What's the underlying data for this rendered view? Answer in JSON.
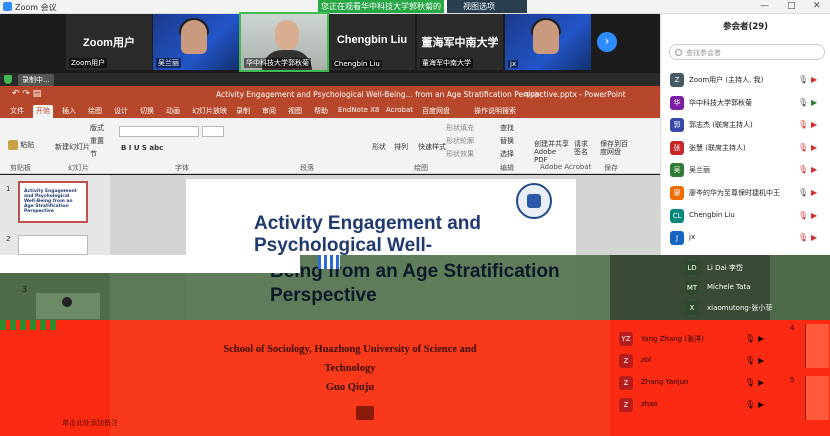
{
  "window": {
    "app_title": "Zoom 会议",
    "share_banner": "您正在观看华中科技大学郭秋菊的屏幕",
    "view_options": "视图选项",
    "controls": [
      "—",
      "□",
      "✕"
    ]
  },
  "gallery": {
    "tiles": [
      {
        "center": "Zoom用户",
        "caption": "Zoom用户"
      },
      {
        "caption": "吴兰丽"
      },
      {
        "caption": "华中科技大学郭秋菊"
      },
      {
        "center": "Chengbin Liu",
        "caption": "Chengbin Liu"
      },
      {
        "center": "董海军中南大学",
        "caption": "董海军中南大学"
      },
      {
        "caption": "jx"
      }
    ],
    "next_arrow": "›"
  },
  "recording": {
    "label": "录制中..."
  },
  "powerpoint": {
    "title": "Activity Engagement and Psychological Well-Being... from an Age Stratification Perspective.pptx - PowerPoint",
    "user": "qiuju",
    "share": "共享",
    "tabs": [
      "文件",
      "开始",
      "插入",
      "绘图",
      "设计",
      "切换",
      "动画",
      "幻灯片放映",
      "录制",
      "审阅",
      "视图",
      "帮助",
      "EndNote X8",
      "Acrobat",
      "百度网盘",
      "操作说明搜索"
    ],
    "active_tab": "开始",
    "ribbon": {
      "paste": "粘贴",
      "new_slide": "新建幻灯片",
      "layout": "版式",
      "reset": "重置",
      "section": "节",
      "shape": "形状",
      "arrange": "排列",
      "quick_styles": "快速样式",
      "shape_fill": "形状填充",
      "shape_outline": "形状轮廓",
      "shape_effect": "形状效果",
      "find": "查找",
      "replace": "替换",
      "select": "选择",
      "create_pdf": "创建并共享 Adobe PDF",
      "request_sign": "请求签名",
      "save_to_baidu": "保存到百度网盘",
      "groups": [
        "剪贴板",
        "幻灯片",
        "字体",
        "段落",
        "绘图",
        "编辑",
        "Adobe Acrobat",
        "保存"
      ]
    },
    "slides_panel": {
      "thumb1": "Activity Engagement and Psychological Well-Being from an Age Stratification Perspective",
      "numbers": [
        "1",
        "2",
        "3"
      ]
    },
    "slide": {
      "heading_top": "Activity Engagement and Psychological Well-",
      "heading_bottom": "Being from an Age Stratification Perspective",
      "affiliation": "School of  Sociology, Huazhong University of Science and Technology",
      "author": "Guo Qiuju",
      "bottom_note": "单击此处添加备注"
    },
    "right_slide_numbers": [
      "4",
      "5"
    ]
  },
  "participants": {
    "title": "参会者(29)",
    "search_placeholder": "查找参会者",
    "list": [
      {
        "initial": "Z",
        "color": "#455a64",
        "name": "Zoom用户 (主持人, 我)",
        "mic": "on",
        "cam": "off"
      },
      {
        "initial": "华",
        "color": "#7b1fa2",
        "name": "华中科技大学郭秋菊",
        "mic": "on",
        "cam": "on"
      },
      {
        "initial": "郭",
        "color": "#3949ab",
        "name": "郭志杰 (联席主持人)",
        "mic": "off",
        "cam": "off"
      },
      {
        "initial": "张",
        "color": "#c62828",
        "name": "张慧 (联席主持人)",
        "mic": "off",
        "cam": "off"
      },
      {
        "initial": "吴",
        "color": "#2e7d32",
        "name": "吴兰丽",
        "mic": "off",
        "cam": "off"
      },
      {
        "initial": "廖",
        "color": "#ef6c00",
        "name": "廖岑的华为至尊保时捷机中王",
        "mic": "on",
        "cam": "off"
      },
      {
        "initial": "CL",
        "color": "#00897b",
        "name": "Chengbin Liu",
        "mic": "off",
        "cam": "off"
      },
      {
        "initial": "J",
        "color": "#1565c0",
        "name": "jx",
        "mic": "off",
        "cam": "off"
      }
    ],
    "dark_list": [
      {
        "initial": "LD",
        "name": "Li Dai 李岱"
      },
      {
        "initial": "MT",
        "name": "Michele Tata"
      },
      {
        "initial": "X",
        "name": "xiaomutong-张小菲"
      }
    ],
    "red_list": [
      {
        "initial": "YZ",
        "name": "Yang Zhang (张洋)"
      },
      {
        "initial": "Z",
        "name": "zbl"
      },
      {
        "initial": "Z",
        "name": "Zhang Yanjun"
      },
      {
        "initial": "Z",
        "name": "zhao"
      }
    ]
  }
}
